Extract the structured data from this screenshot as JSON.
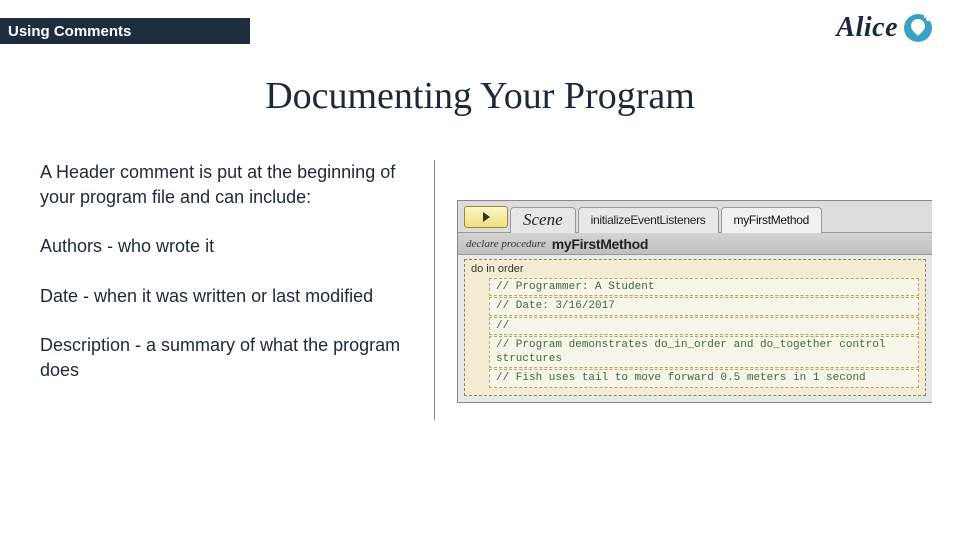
{
  "header": {
    "band": "Using Comments"
  },
  "logo": {
    "text": "Alice"
  },
  "title": "Documenting Your Program",
  "body": {
    "p1": "A Header comment is put at the beginning of your program file and can include:",
    "p2": "Authors - who wrote it",
    "p3": "Date - when it was written or last modified",
    "p4": "Description - a summary of what the program does"
  },
  "editor": {
    "tabs": {
      "scene": "Scene",
      "init": "initializeEventListeners",
      "method": "myFirstMethod"
    },
    "declare_prefix": "declare procedure",
    "declare_name": "myFirstMethod",
    "order_label": "do in order",
    "comments": [
      "// Programmer: A Student",
      "// Date: 3/16/2017",
      "//",
      "// Program demonstrates do_in_order and do_together control structures",
      "// Fish uses tail to move forward 0.5 meters in 1 second"
    ]
  }
}
